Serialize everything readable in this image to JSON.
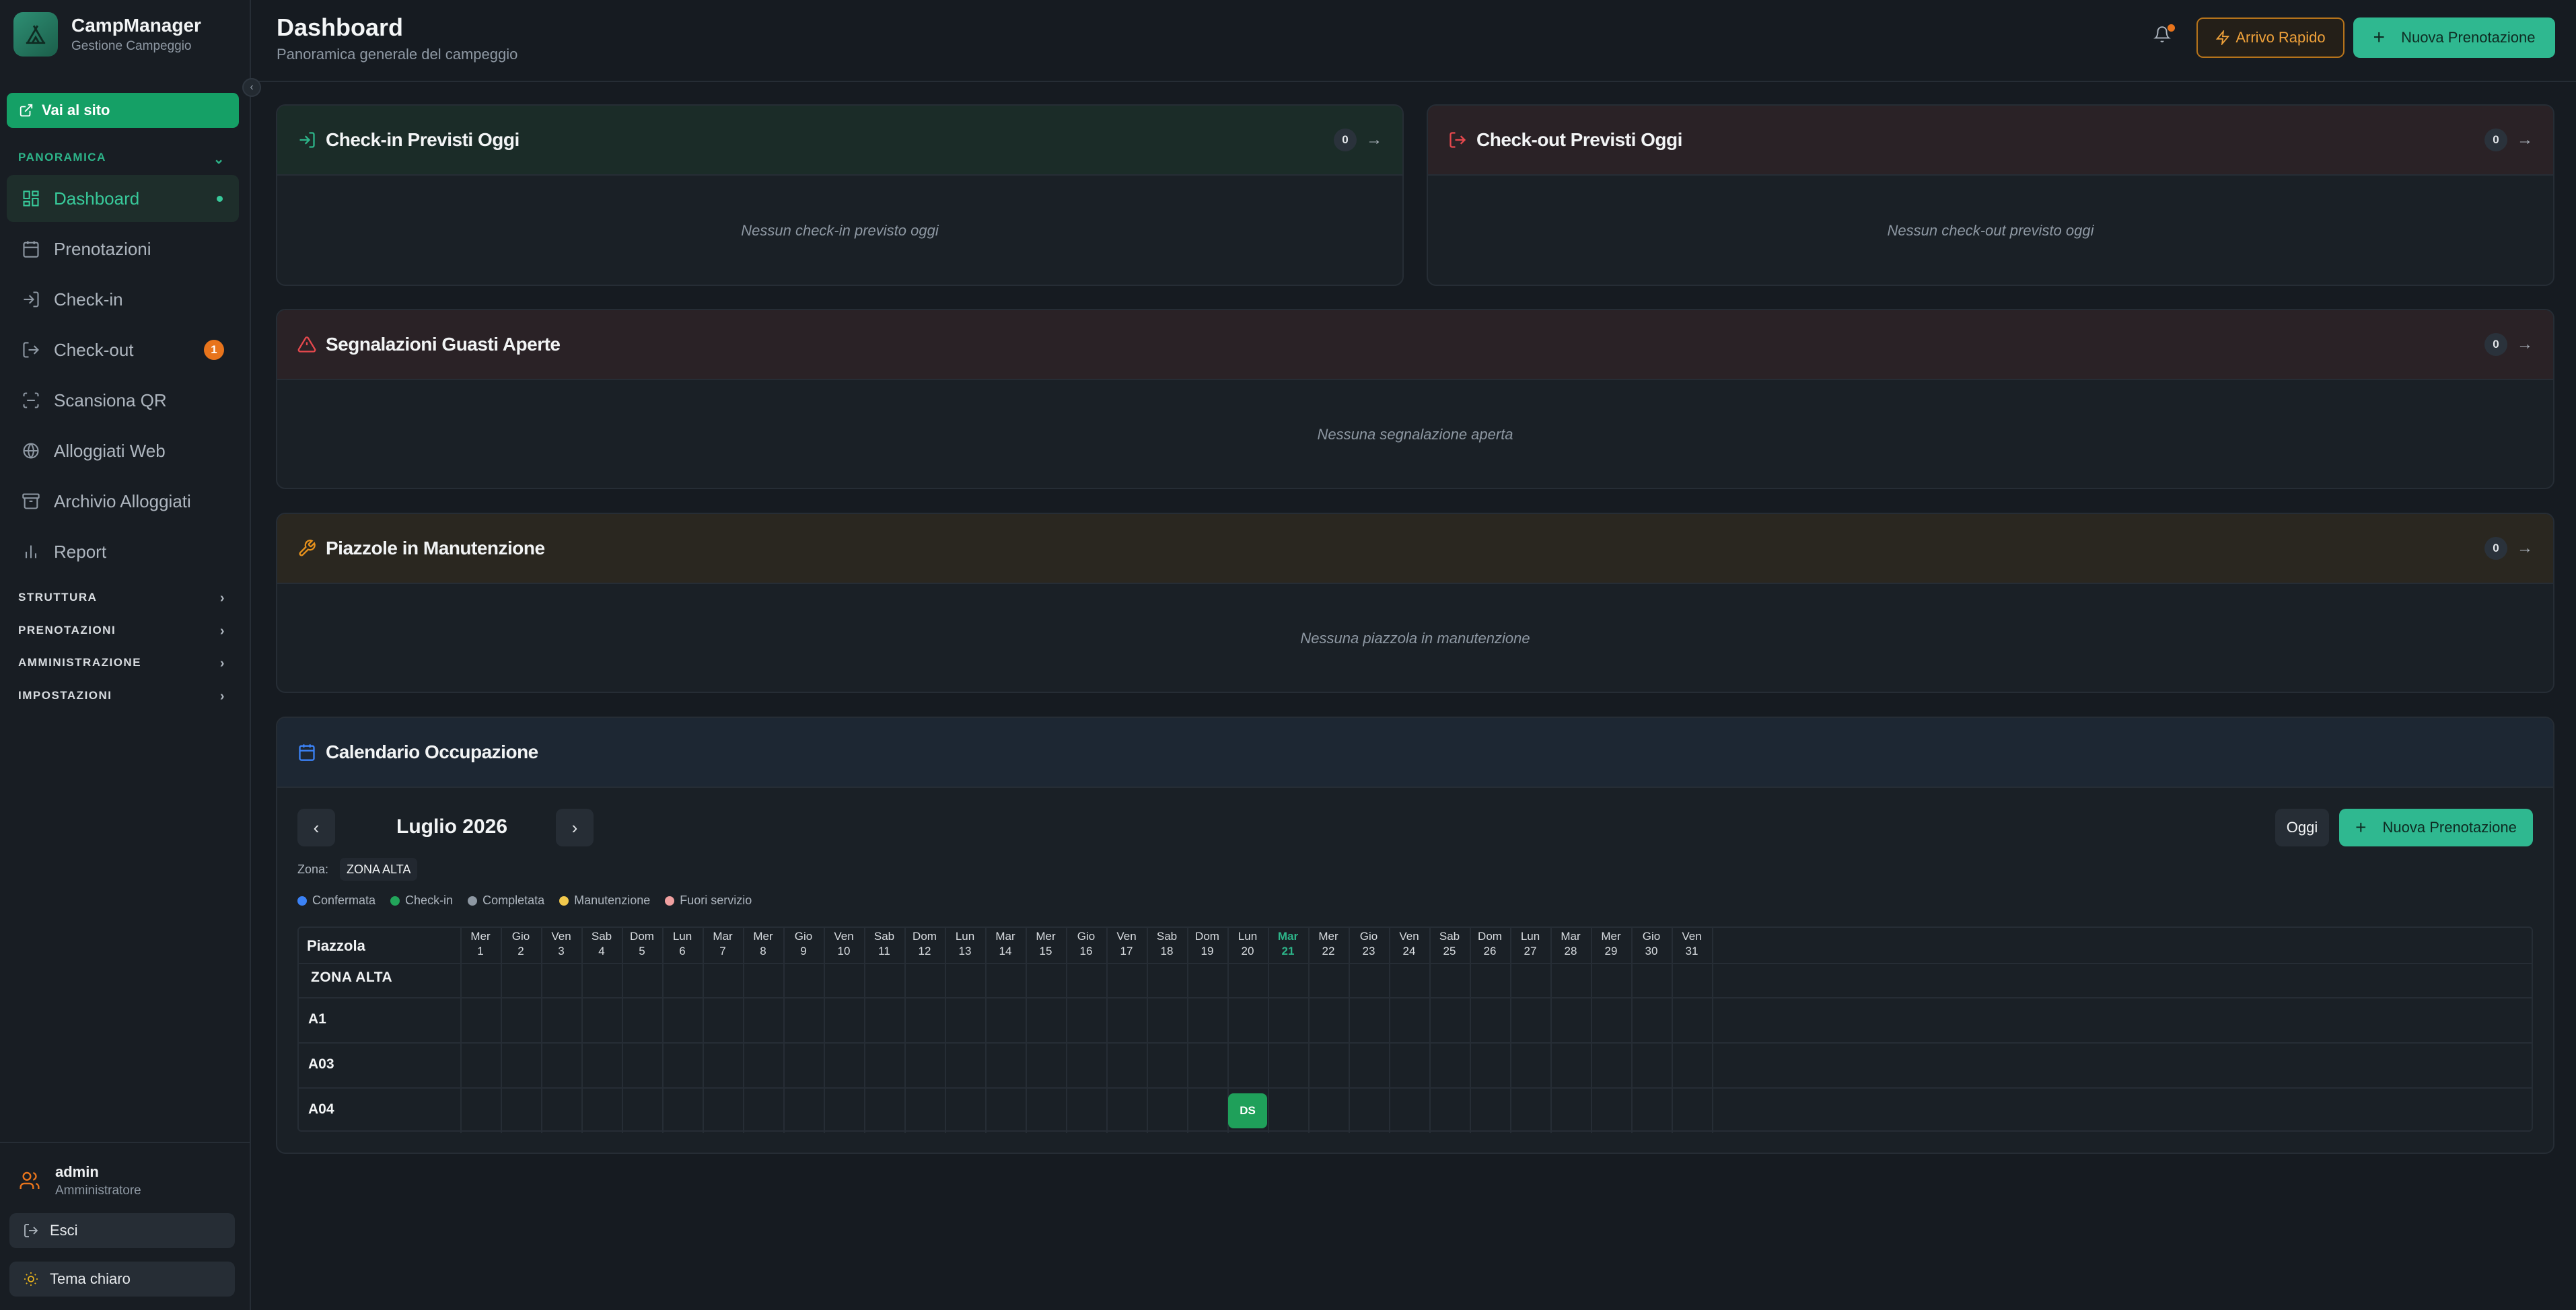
{
  "app": {
    "name": "CampManager",
    "subtitle": "Gestione Campeggio"
  },
  "sidebar": {
    "site_button": "Vai al sito",
    "sections": {
      "panoramica": "PANORAMICA",
      "struttura": "STRUTTURA",
      "prenotazioni": "PRENOTAZIONI",
      "amministrazione": "AMMINISTRAZIONE",
      "impostazioni": "IMPOSTAZIONI"
    },
    "items": [
      {
        "label": "Dashboard",
        "icon": "dashboard-icon",
        "active": true
      },
      {
        "label": "Prenotazioni",
        "icon": "calendar-icon"
      },
      {
        "label": "Check-in",
        "icon": "login-icon"
      },
      {
        "label": "Check-out",
        "icon": "logout-icon",
        "badge": "1"
      },
      {
        "label": "Scansiona QR",
        "icon": "scan-icon"
      },
      {
        "label": "Alloggiati Web",
        "icon": "globe-icon"
      },
      {
        "label": "Archivio Alloggiati",
        "icon": "archive-icon"
      },
      {
        "label": "Report",
        "icon": "bar-chart-icon"
      }
    ],
    "user": {
      "name": "admin",
      "role": "Amministratore"
    },
    "logout_label": "Esci",
    "theme_label": "Tema chiaro"
  },
  "header": {
    "title": "Dashboard",
    "subtitle": "Panoramica generale del campeggio",
    "arrivo_label": "Arrivo Rapido",
    "nuova_label": "Nuova Prenotazione"
  },
  "cards": {
    "checkin": {
      "title": "Check-in Previsti Oggi",
      "count": "0",
      "empty": "Nessun check-in previsto oggi"
    },
    "checkout": {
      "title": "Check-out Previsti Oggi",
      "count": "0",
      "empty": "Nessun check-out previsto oggi"
    },
    "guasti": {
      "title": "Segnalazioni Guasti Aperte",
      "count": "0",
      "empty": "Nessuna segnalazione aperta"
    },
    "manutenzione": {
      "title": "Piazzole in Manutenzione",
      "count": "0",
      "empty": "Nessuna piazzola in manutenzione"
    }
  },
  "calendar": {
    "title": "Calendario Occupazione",
    "month": "Luglio 2026",
    "today_label": "Oggi",
    "new_label": "Nuova Prenotazione",
    "zone_label": "Zona:",
    "zone_value": "ZONA ALTA",
    "legend": [
      {
        "label": "Confermata",
        "color": "#3b82f6"
      },
      {
        "label": "Check-in",
        "color": "#22a55a"
      },
      {
        "label": "Completata",
        "color": "#8e98a3"
      },
      {
        "label": "Manutenzione",
        "color": "#f2c94c"
      },
      {
        "label": "Fuori servizio",
        "color": "#f0a0a0"
      }
    ],
    "column_header": "Piazzola",
    "zone_row": "ZONA ALTA",
    "today_day": 21,
    "days": [
      {
        "dow": "Mer",
        "num": "1"
      },
      {
        "dow": "Gio",
        "num": "2"
      },
      {
        "dow": "Ven",
        "num": "3"
      },
      {
        "dow": "Sab",
        "num": "4"
      },
      {
        "dow": "Dom",
        "num": "5"
      },
      {
        "dow": "Lun",
        "num": "6"
      },
      {
        "dow": "Mar",
        "num": "7"
      },
      {
        "dow": "Mer",
        "num": "8"
      },
      {
        "dow": "Gio",
        "num": "9"
      },
      {
        "dow": "Ven",
        "num": "10"
      },
      {
        "dow": "Sab",
        "num": "11"
      },
      {
        "dow": "Dom",
        "num": "12"
      },
      {
        "dow": "Lun",
        "num": "13"
      },
      {
        "dow": "Mar",
        "num": "14"
      },
      {
        "dow": "Mer",
        "num": "15"
      },
      {
        "dow": "Gio",
        "num": "16"
      },
      {
        "dow": "Ven",
        "num": "17"
      },
      {
        "dow": "Sab",
        "num": "18"
      },
      {
        "dow": "Dom",
        "num": "19"
      },
      {
        "dow": "Lun",
        "num": "20"
      },
      {
        "dow": "Mar",
        "num": "21"
      },
      {
        "dow": "Mer",
        "num": "22"
      },
      {
        "dow": "Gio",
        "num": "23"
      },
      {
        "dow": "Ven",
        "num": "24"
      },
      {
        "dow": "Sab",
        "num": "25"
      },
      {
        "dow": "Dom",
        "num": "26"
      },
      {
        "dow": "Lun",
        "num": "27"
      },
      {
        "dow": "Mar",
        "num": "28"
      },
      {
        "dow": "Mer",
        "num": "29"
      },
      {
        "dow": "Gio",
        "num": "30"
      },
      {
        "dow": "Ven",
        "num": "31"
      }
    ],
    "pitches": [
      "A1",
      "A03",
      "A04"
    ],
    "bookings": [
      {
        "pitch": "A04",
        "day": 20,
        "label": "DS",
        "status": "Check-in"
      }
    ]
  }
}
